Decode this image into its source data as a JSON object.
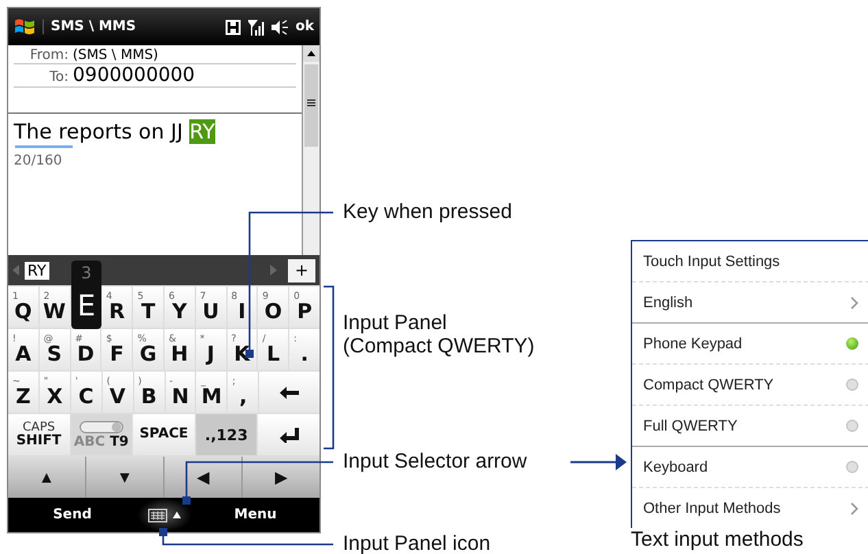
{
  "phone": {
    "title_bar": {
      "title": "SMS \\ MMS",
      "ok": "ok"
    },
    "header": [
      {
        "label": "From:",
        "value": "(SMS \\ MMS)",
        "kind": "from"
      },
      {
        "label": "To:",
        "value": "0900000000",
        "kind": "to"
      }
    ],
    "message": {
      "text": "The reports on JJ ",
      "composing": "RY",
      "counter": "20/160"
    },
    "candidate_bar": {
      "candidate": "RY",
      "add": "+"
    },
    "keyboard": {
      "rows": [
        {
          "keys": [
            {
              "kind": "char",
              "sub": "1",
              "main": "Q"
            },
            {
              "kind": "char",
              "sub": "2",
              "main": "W"
            },
            {
              "kind": "char",
              "sub": "3",
              "main": "E",
              "pressed": true
            },
            {
              "kind": "char",
              "sub": "4",
              "main": "R"
            },
            {
              "kind": "char",
              "sub": "5",
              "main": "T"
            },
            {
              "kind": "char",
              "sub": "6",
              "main": "Y"
            },
            {
              "kind": "char",
              "sub": "7",
              "main": "U"
            },
            {
              "kind": "char",
              "sub": "8",
              "main": "I"
            },
            {
              "kind": "char",
              "sub": "9",
              "main": "O"
            },
            {
              "kind": "char",
              "sub": "0",
              "main": "P"
            }
          ]
        },
        {
          "keys": [
            {
              "kind": "char",
              "sub": "!",
              "main": "A"
            },
            {
              "kind": "char",
              "sub": "@",
              "main": "S"
            },
            {
              "kind": "char",
              "sub": "#",
              "main": "D"
            },
            {
              "kind": "char",
              "sub": "$",
              "main": "F"
            },
            {
              "kind": "char",
              "sub": "%",
              "main": "G"
            },
            {
              "kind": "char",
              "sub": "&",
              "main": "H"
            },
            {
              "kind": "char",
              "sub": "*",
              "main": "J"
            },
            {
              "kind": "char",
              "sub": "?",
              "main": "K"
            },
            {
              "kind": "char",
              "sub": "/",
              "main": "L"
            },
            {
              "kind": "char",
              "sub": ":",
              "main": "."
            }
          ]
        },
        {
          "keys": [
            {
              "kind": "char",
              "sub": "~",
              "main": "Z"
            },
            {
              "kind": "char",
              "sub": "\"",
              "main": "X"
            },
            {
              "kind": "char",
              "sub": "'",
              "main": "C"
            },
            {
              "kind": "char",
              "sub": "(",
              "main": "V"
            },
            {
              "kind": "char",
              "sub": ")",
              "main": "B"
            },
            {
              "kind": "char",
              "sub": "-",
              "main": "N"
            },
            {
              "kind": "char",
              "sub": "_",
              "main": "M"
            },
            {
              "kind": "char",
              "sub": ";",
              "main": ","
            },
            {
              "kind": "backspace"
            }
          ]
        },
        {
          "keys": [
            {
              "kind": "label",
              "sub": "CAPS",
              "main": "SHIFT"
            },
            {
              "kind": "toggle",
              "sub": "ABC",
              "main": "T9"
            },
            {
              "kind": "label",
              "main": "SPACE"
            },
            {
              "kind": "mode",
              "main": ".,123"
            },
            {
              "kind": "enter"
            }
          ]
        }
      ],
      "arrows": [
        "▲",
        "▼",
        "◀",
        "▶"
      ]
    },
    "soft_keys": {
      "left": "Send",
      "right": "Menu"
    }
  },
  "callouts": [
    {
      "kind": "key",
      "text": "Key when pressed"
    },
    {
      "kind": "panel",
      "text": "Input Panel\n(Compact QWERTY)"
    },
    {
      "kind": "selector",
      "text": "Input Selector arrow"
    },
    {
      "kind": "icon",
      "text": "Input Panel icon"
    }
  ],
  "input_methods": {
    "items": [
      {
        "kind": "header",
        "label": "Touch Input Settings"
      },
      {
        "kind": "link",
        "label": "English"
      },
      {
        "kind": "radio",
        "label": "Phone Keypad",
        "selected": true
      },
      {
        "kind": "radio",
        "label": "Compact QWERTY",
        "selected": false
      },
      {
        "kind": "radio",
        "label": "Full QWERTY",
        "selected": false
      },
      {
        "kind": "radio",
        "label": "Keyboard",
        "selected": false
      },
      {
        "kind": "link",
        "label": "Other Input Methods"
      }
    ],
    "caption": "Text input methods"
  }
}
